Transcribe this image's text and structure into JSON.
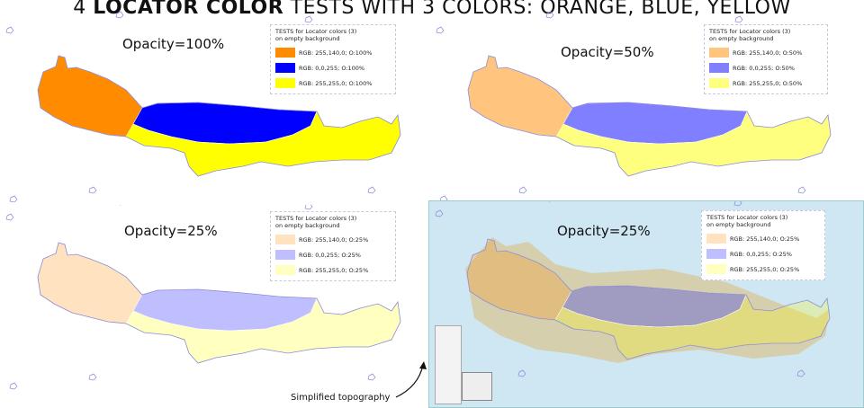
{
  "title": {
    "prefix": "4 ",
    "bold": "LOCATOR COLOR",
    "suffix": " TESTS WITH 3 COLORS: ORANGE, BLUE, YELLOW"
  },
  "colors": {
    "orange": "#ff8c00",
    "blue": "#0000ff",
    "yellow": "#ffff00",
    "sea": "#cfe6f3",
    "terrain": "#c9a75a"
  },
  "legend_title": [
    "TESTS for Locator colors (3)",
    "on empty background"
  ],
  "panels": [
    {
      "opacity_label": "Opacity=100%",
      "opacity": 1.0,
      "legend": [
        "RGB: 255,140,0; O:100%",
        "RGB: 0,0,255; O:100%",
        "RGB: 255,255,0; O:100%"
      ]
    },
    {
      "opacity_label": "Opacity=50%",
      "opacity": 0.5,
      "legend": [
        "RGB: 255,140,0; O:50%",
        "RGB: 0,0,255; O:50%",
        "RGB: 255,255,0; O:50%"
      ]
    },
    {
      "opacity_label": "Opacity=25%",
      "opacity": 0.25,
      "legend": [
        "RGB: 255,140,0; O:25%",
        "RGB: 0,0,255; O:25%",
        "RGB: 255,255,0; O:25%"
      ]
    },
    {
      "opacity_label": "Opacity=25%",
      "opacity": 0.25,
      "legend": [
        "RGB: 255,140,0; O:25%",
        "RGB: 0,0,255; O:25%",
        "RGB: 255,255,0; O:25%"
      ]
    }
  ],
  "topography_label": "Simplified topography"
}
